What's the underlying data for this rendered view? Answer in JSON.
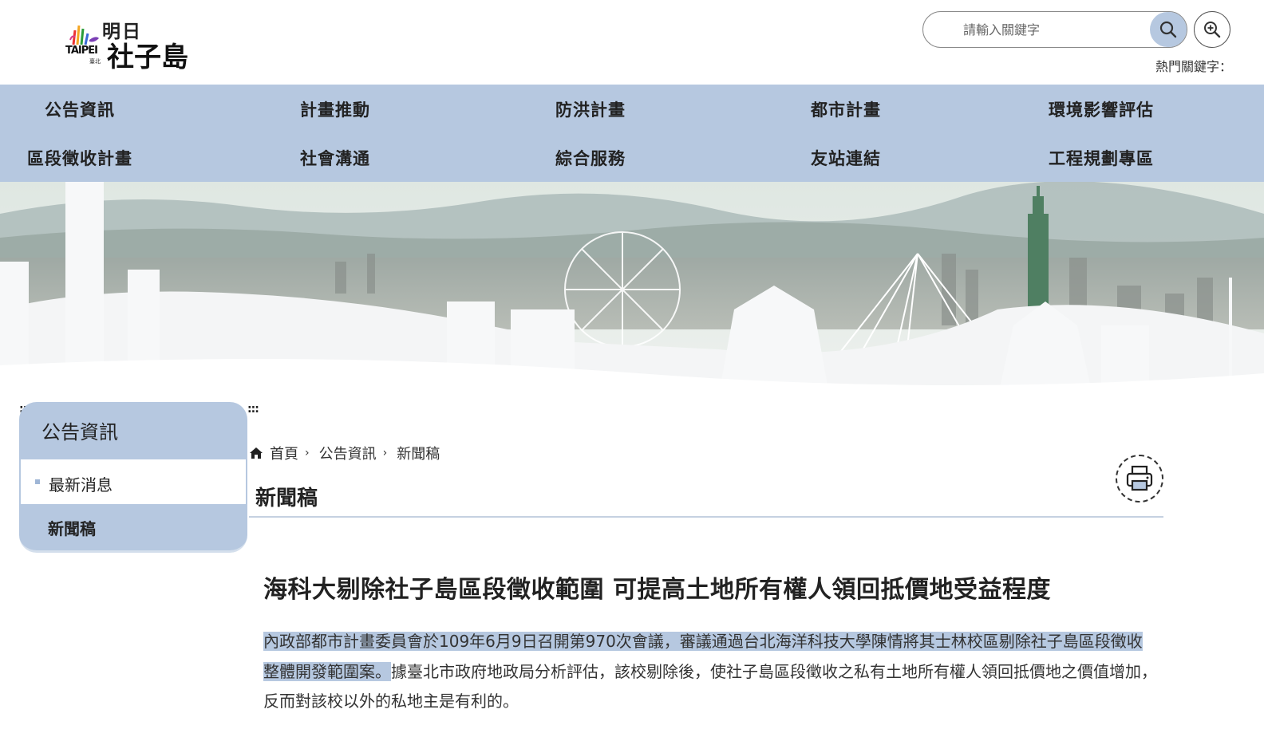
{
  "logo": {
    "taipei": "TAIPEI",
    "taipei_sub": "臺北",
    "ming": "明日",
    "name": "社子島"
  },
  "search": {
    "placeholder": "請輸入關鍵字",
    "hot_keywords_label": "熱門關鍵字："
  },
  "nav": {
    "row1": [
      "公告資訊",
      "計畫推動",
      "防洪計畫",
      "都市計畫",
      "環境影響評估"
    ],
    "row2": [
      "區段徵收計畫",
      "社會溝通",
      "綜合服務",
      "友站連結",
      "工程規劃專區"
    ]
  },
  "accesskey": ":::",
  "sidebar": {
    "title": "公告資訊",
    "items": [
      {
        "label": "最新消息"
      },
      {
        "label": "新聞稿"
      }
    ]
  },
  "breadcrumb": [
    "首頁",
    "公告資訊",
    "新聞稿"
  ],
  "breadcrumb_sep": "›",
  "page_title": "新聞稿",
  "article": {
    "title": "海科大剔除社子島區段徵收範圍 可提高土地所有權人領回抵價地受益程度",
    "highlighted_text": "內政部都市計畫委員會於109年6月9日召開第970次會議，審議通過台北海洋科技大學陳情將其士林校區剔除社子島區段徵收整體開發範圍案。",
    "rest_text": "據臺北市政府地政局分析評估，該校剔除後，使社子島區段徵收之私有土地所有權人領回抵價地之價值增加，反而對該校以外的私地主是有利的。"
  },
  "colors": {
    "accent": "#b6c8e0",
    "text": "#333333"
  }
}
